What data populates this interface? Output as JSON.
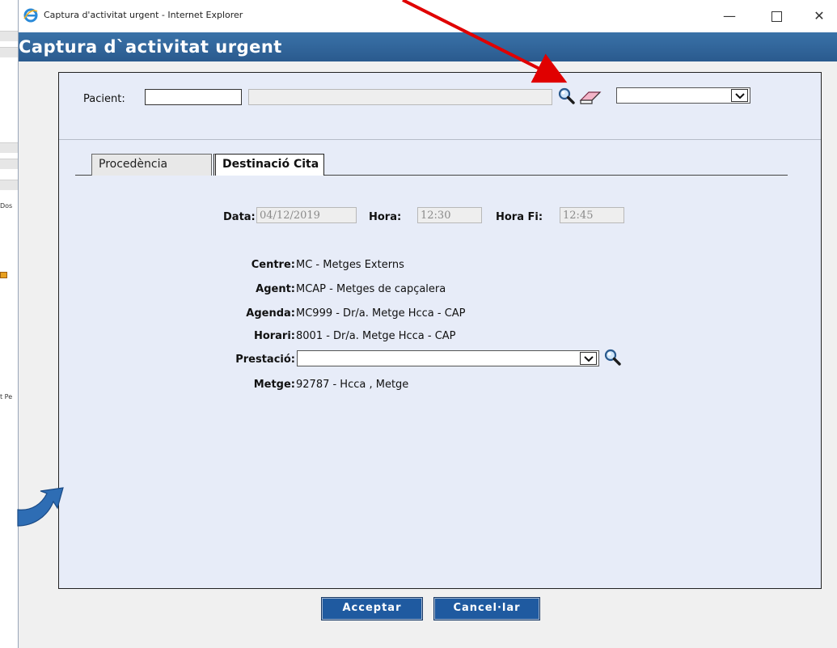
{
  "window": {
    "title": "Captura d'activitat urgent - Internet Explorer",
    "minimize": "—",
    "close": "✕"
  },
  "app": {
    "header": "Captura d`activitat urgent"
  },
  "background_window": {
    "fragments": [
      "Dos",
      "t Pe"
    ]
  },
  "patient": {
    "label": "Pacient:",
    "code_value": "",
    "name_value": "",
    "select_value": "",
    "search_icon": "magnifier-icon",
    "clear_icon": "eraser-icon"
  },
  "tabs": [
    {
      "label": "Procedència",
      "active": false
    },
    {
      "label": "Destinació Cita",
      "active": true
    }
  ],
  "appointment": {
    "date_label": "Data:",
    "date_value": "04/12/2019",
    "hour_label": "Hora:",
    "hour_value": "12:30",
    "hour_end_label": "Hora Fi:",
    "hour_end_value": "12:45"
  },
  "details": {
    "centre_label": "Centre:",
    "centre_value": "MC - Metges Externs",
    "agent_label": "Agent:",
    "agent_value": "MCAP - Metges de capçalera",
    "agenda_label": "Agenda:",
    "agenda_value": "MC999 - Dr/a. Metge Hcca - CAP",
    "horari_label": "Horari:",
    "horari_value": "8001 - Dr/a. Metge Hcca - CAP",
    "prestacio_label": "Prestació:",
    "prestacio_value": "",
    "metge_label": "Metge:",
    "metge_value": "92787 - Hcca , Metge"
  },
  "buttons": {
    "accept": "Acceptar",
    "cancel": "Cancel·lar"
  },
  "colors": {
    "header_blue": "#2a5a8e",
    "panel_bg": "#e7ecf8",
    "button_blue": "#1f5aa0",
    "annotation_red": "#e00000",
    "annotation_arrow_blue": "#2e6db4"
  }
}
